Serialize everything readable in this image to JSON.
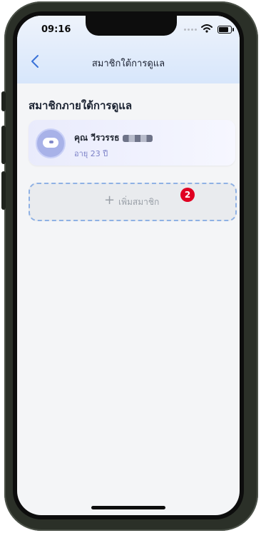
{
  "status_bar": {
    "time": "09:16"
  },
  "nav": {
    "title": "สมาชิกใต้การดูแล"
  },
  "section": {
    "title": "สมาชิกภายใต้การดูแล"
  },
  "members": [
    {
      "name": "คุณ วีรวรรธ",
      "age": "อายุ 23 ปี"
    }
  ],
  "add_member": {
    "plus": "+",
    "label": "เพิ่มสมาชิก"
  },
  "annotation": {
    "badge": "2"
  },
  "colors": {
    "accent": "#7b80c7",
    "badge": "#e00021",
    "dashed_border": "#8fb1e4"
  }
}
